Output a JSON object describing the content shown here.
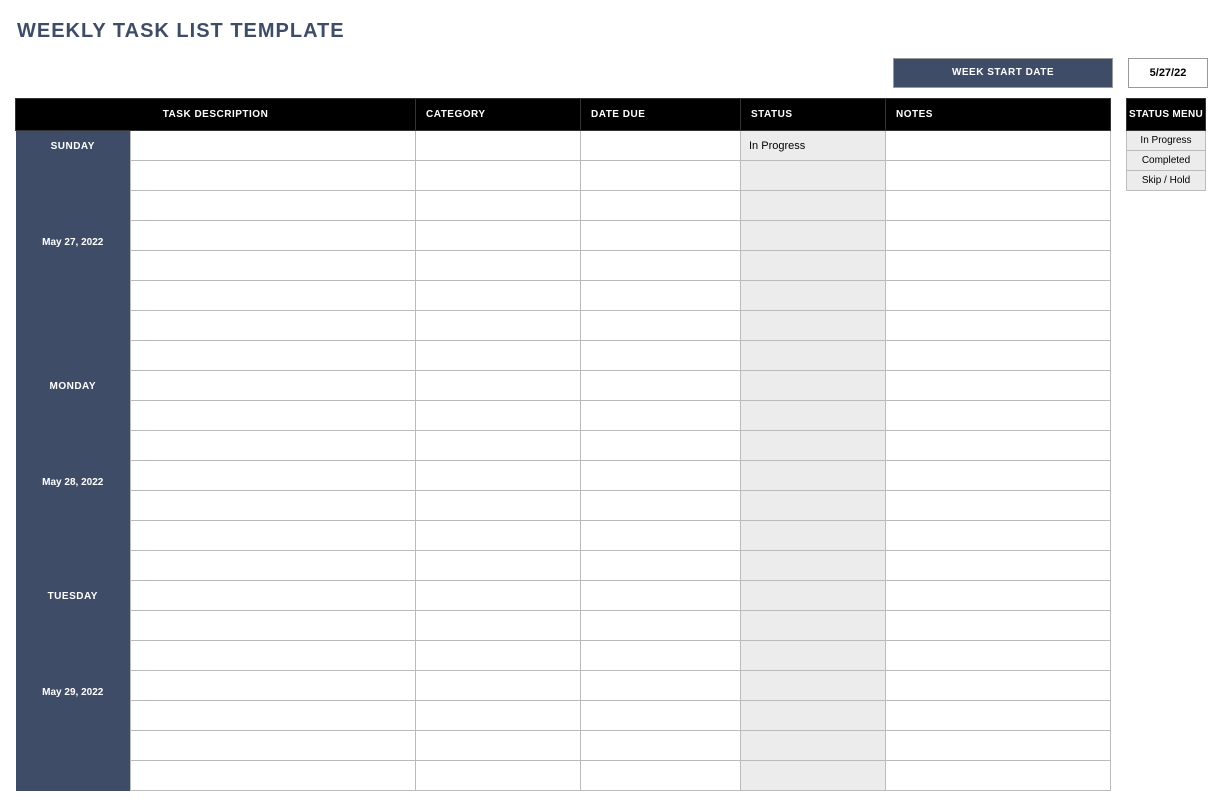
{
  "title": "WEEKLY TASK LIST TEMPLATE",
  "week_start": {
    "label": "WEEK START DATE",
    "value": "5/27/22"
  },
  "columns": {
    "description": "TASK DESCRIPTION",
    "category": "CATEGORY",
    "date_due": "DATE DUE",
    "status": "STATUS",
    "notes": "NOTES"
  },
  "days": [
    {
      "name": "SUNDAY",
      "date": "May 27, 2022",
      "rows": 8,
      "first_status": "In Progress"
    },
    {
      "name": "MONDAY",
      "date": "May 28, 2022",
      "rows": 7,
      "first_status": ""
    },
    {
      "name": "TUESDAY",
      "date": "May 29, 2022",
      "rows": 7,
      "first_status": ""
    }
  ],
  "status_menu": {
    "header": "STATUS MENU",
    "options": [
      "In Progress",
      "Completed",
      "Skip / Hold"
    ]
  }
}
